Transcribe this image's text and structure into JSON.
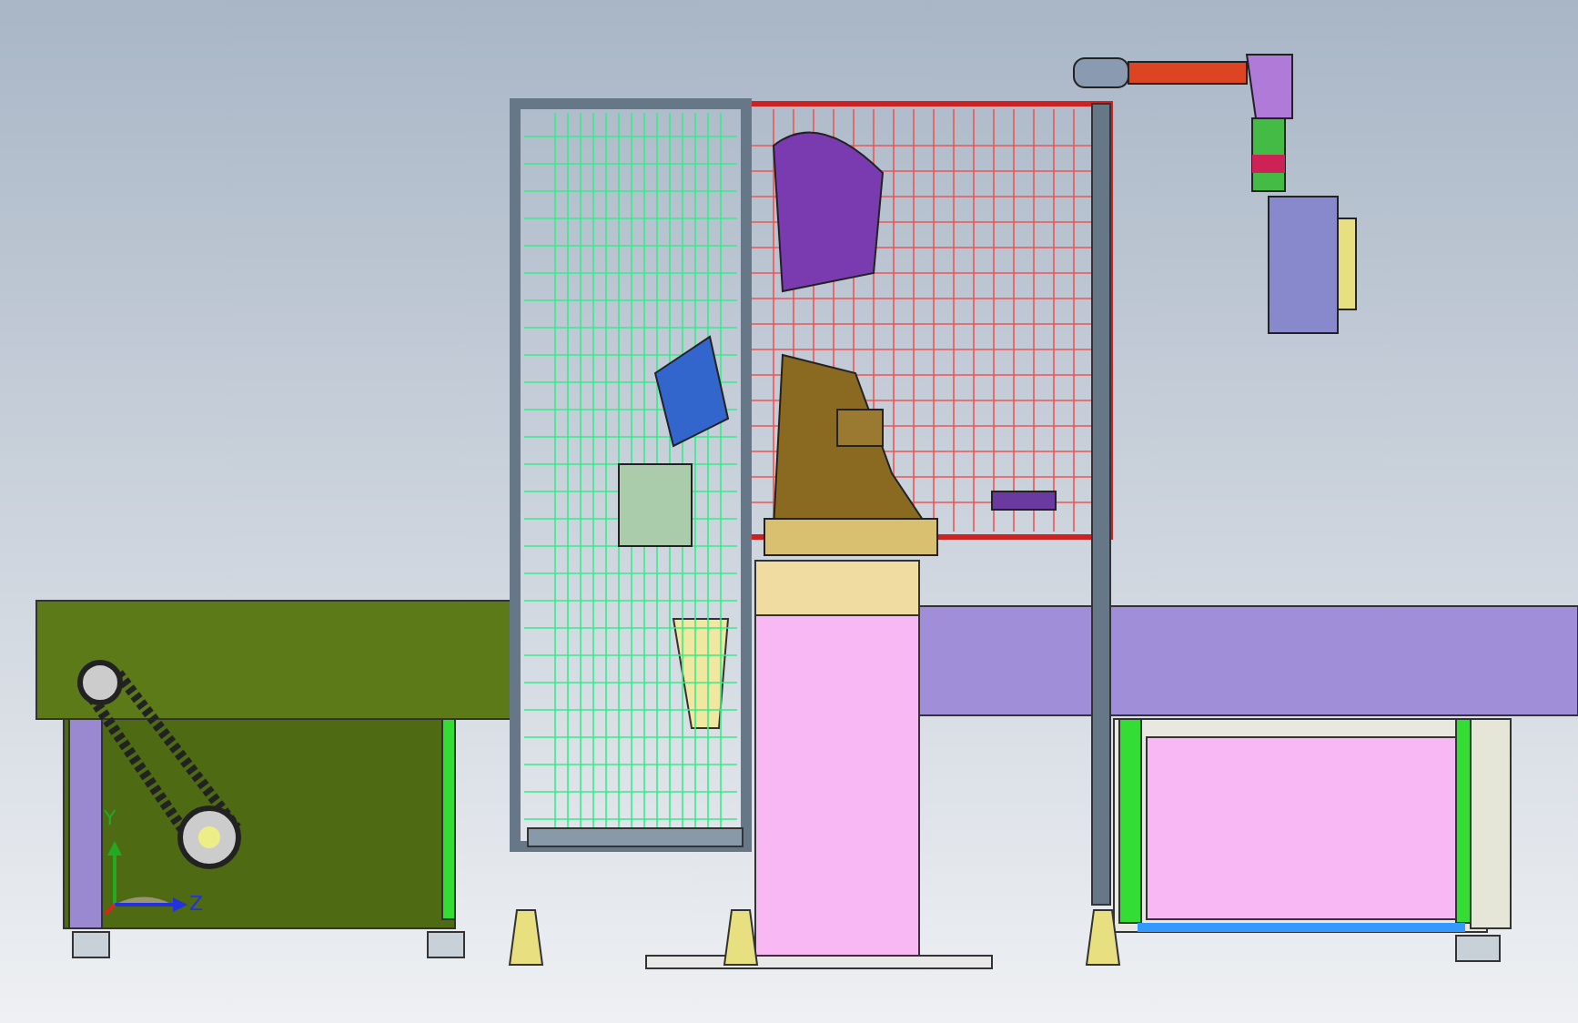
{
  "viewport": {
    "triad": {
      "y_label": "Y",
      "z_label": "Z"
    }
  }
}
